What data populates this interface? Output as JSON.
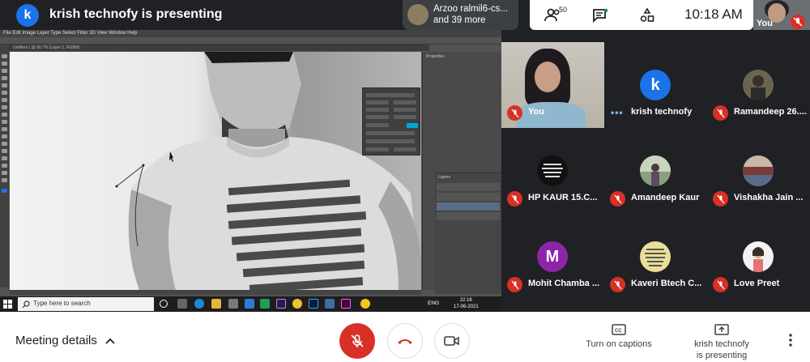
{
  "presenting_banner": {
    "avatar_letter": "k",
    "title": "krish technofy is presenting"
  },
  "people_chip": {
    "line1": "Arzoo ralmil6-cs...",
    "line2": "and 39 more"
  },
  "controls": {
    "participant_count": "50",
    "time": "10:18 AM"
  },
  "self_view": {
    "label": "You"
  },
  "shared_screen": {
    "menu_items": "File  Edit  Image  Layer  Type  Select  Filter  3D  View  Window  Help",
    "doc_tab": "Untitled-1 @ 66.7% (Layer 1, RGB/8)",
    "panel_properties": "Properties",
    "panel_layers": "Layers",
    "taskbar": {
      "search_placeholder": "Type here to search",
      "lang": "ENG",
      "time": "22:16",
      "date": "17-06-2021"
    }
  },
  "participants": [
    {
      "name": "You",
      "avatar": "video",
      "muted": true
    },
    {
      "name": "krish technofy",
      "avatar_letter": "k",
      "avatar_color": "#1a73e8",
      "muted": false,
      "speaking": true
    },
    {
      "name": "Ramandeep 26....",
      "avatar": "photo",
      "avatar_color": "#6c6452",
      "muted": true
    },
    {
      "name": "HP KAUR 15.C...",
      "avatar": "quote",
      "avatar_color": "#111111",
      "muted": true
    },
    {
      "name": "Amandeep Kaur",
      "avatar": "photo",
      "avatar_color": "#7a8a6a",
      "muted": true
    },
    {
      "name": "Vishakha Jain ...",
      "avatar": "photo",
      "avatar_color": "#9b6f6f",
      "muted": true
    },
    {
      "name": "Mohit Chamba ...",
      "avatar_letter": "M",
      "avatar_color": "#8e24aa",
      "muted": true
    },
    {
      "name": "Kaveri Btech C...",
      "avatar": "quote",
      "avatar_color": "#e9df9a",
      "muted": true
    },
    {
      "name": "Love Preet",
      "avatar": "photo",
      "avatar_color": "#f2f2f2",
      "muted": true
    }
  ],
  "bottom_bar": {
    "meeting_details": "Meeting details",
    "captions_label": "Turn on captions",
    "present_line1": "krish technofy",
    "present_line2": "is presenting"
  }
}
